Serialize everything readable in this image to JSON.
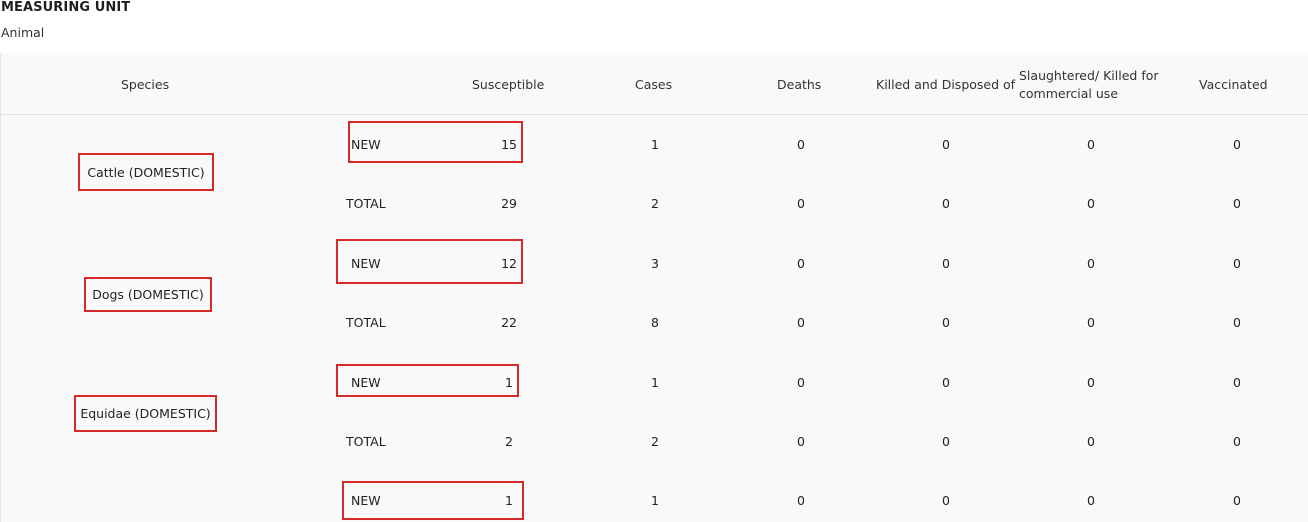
{
  "measuring_unit": {
    "heading": "MEASURING UNIT",
    "value": "Animal"
  },
  "table": {
    "headers": {
      "species": "Species",
      "susceptible": "Susceptible",
      "cases": "Cases",
      "deaths": "Deaths",
      "killed": "Killed and Disposed of",
      "slaughtered": "Slaughtered/ Killed for commercial use",
      "vaccinated": "Vaccinated"
    },
    "species": [
      {
        "name": "Cattle (DOMESTIC)"
      },
      {
        "name": "Dogs (DOMESTIC)"
      },
      {
        "name": "Equidae (DOMESTIC)"
      }
    ],
    "rows": [
      {
        "label": "NEW",
        "susceptible": "15",
        "cases": "1",
        "deaths": "0",
        "killed": "0",
        "slaughtered": "0",
        "vaccinated": "0"
      },
      {
        "label": "TOTAL",
        "susceptible": "29",
        "cases": "2",
        "deaths": "0",
        "killed": "0",
        "slaughtered": "0",
        "vaccinated": "0"
      },
      {
        "label": "NEW",
        "susceptible": "12",
        "cases": "3",
        "deaths": "0",
        "killed": "0",
        "slaughtered": "0",
        "vaccinated": "0"
      },
      {
        "label": "TOTAL",
        "susceptible": "22",
        "cases": "8",
        "deaths": "0",
        "killed": "0",
        "slaughtered": "0",
        "vaccinated": "0"
      },
      {
        "label": "NEW",
        "susceptible": "1",
        "cases": "1",
        "deaths": "0",
        "killed": "0",
        "slaughtered": "0",
        "vaccinated": "0"
      },
      {
        "label": "TOTAL",
        "susceptible": "2",
        "cases": "2",
        "deaths": "0",
        "killed": "0",
        "slaughtered": "0",
        "vaccinated": "0"
      },
      {
        "label": "NEW",
        "susceptible": "1",
        "cases": "1",
        "deaths": "0",
        "killed": "0",
        "slaughtered": "0",
        "vaccinated": "0"
      }
    ]
  }
}
